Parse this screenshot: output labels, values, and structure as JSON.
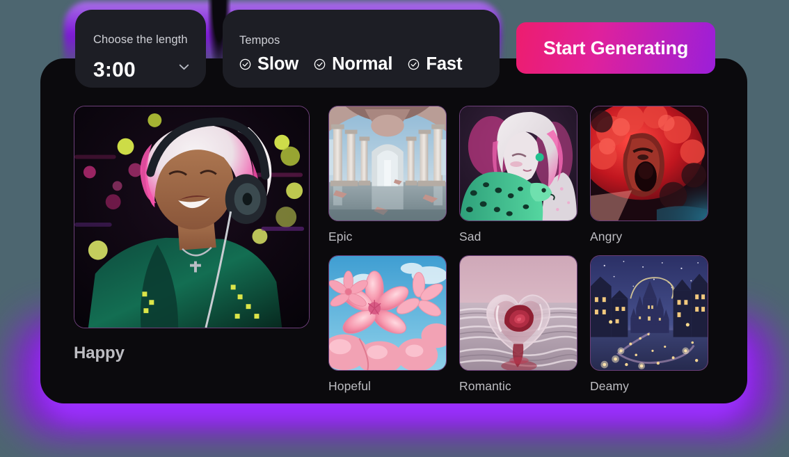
{
  "length_card": {
    "label": "Choose the length",
    "value": "3:00",
    "chevron_icon": "chevron-down-icon"
  },
  "tempo_card": {
    "label": "Tempos",
    "options": [
      {
        "label": "Slow",
        "icon": "check-circle-icon",
        "selected": true
      },
      {
        "label": "Normal",
        "icon": "check-circle-icon",
        "selected": true
      },
      {
        "label": "Fast",
        "icon": "check-circle-icon",
        "selected": true
      }
    ]
  },
  "primary_action": {
    "label": "Start Generating",
    "gradient_from": "#ed1d6e",
    "gradient_to": "#9b1fd9"
  },
  "hero": {
    "label": "Happy",
    "description": "Smiling person with pink and white hair wearing headphones and a green jacket, colorful bokeh lights"
  },
  "moods": [
    {
      "label": "Epic",
      "description": "Grand ruined cathedral interior with marble columns reflected in water"
    },
    {
      "label": "Sad",
      "description": "Pale white-haired figure embracing a green leopard under pink neon light"
    },
    {
      "label": "Angry",
      "description": "Screaming face emerging from red smoke and teal haze"
    },
    {
      "label": "Hopeful",
      "description": "Pink blossoms against a bright blue sky with clouds"
    },
    {
      "label": "Romantic",
      "description": "Translucent glass heart holding a red rose above rippling water"
    },
    {
      "label": "Deamy",
      "description": "Fairytale castle at night on a cobblestone street with glowing lights"
    }
  ],
  "theme": {
    "page_background": "#4d6670",
    "panel_background": "#0b0a0d",
    "card_background": "#1d1e25",
    "glow_color": "#9b30ff",
    "label_color": "#bdbdc2",
    "thumb_border": "#6d3f7a"
  }
}
